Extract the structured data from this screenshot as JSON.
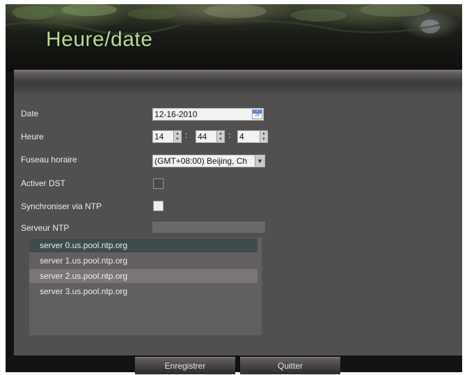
{
  "window": {
    "title": "Heure/date"
  },
  "form": {
    "date_label": "Date",
    "date_value": "12-16-2010",
    "calendar_icon": "calendar-icon",
    "time_label": "Heure",
    "hour": "14",
    "minute": "44",
    "second": "4",
    "colon": ":",
    "timezone_label": "Fuseau horaire",
    "timezone_value": "(GMT+08:00) Beijing, Ch",
    "dst_label": "Activer DST",
    "dst_checked": false,
    "ntp_sync_label": "Synchroniser via NTP",
    "ntp_sync_checked": false,
    "ntp_server_label": "Serveur NTP",
    "ntp_server_value": ""
  },
  "ntp_servers": [
    "server 0.us.pool.ntp.org",
    "server 1.us.pool.ntp.org",
    "server 2.us.pool.ntp.org",
    "server 3.us.pool.ntp.org"
  ],
  "buttons": {
    "save": "Enregistrer",
    "quit": "Quitter"
  },
  "colors": {
    "title": "#b9dd8f",
    "panel": "#535052",
    "selected_row": "#3e4a4e"
  }
}
